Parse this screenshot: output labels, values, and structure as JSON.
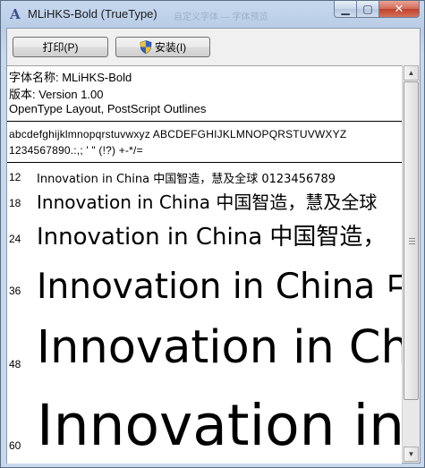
{
  "window": {
    "title": "MLiHKS-Bold (TrueType)",
    "ghost_title": "自定义字体 — 字体预览",
    "minimize_glyph": "▁",
    "maximize_glyph": "▢",
    "close_glyph": "✕"
  },
  "toolbar": {
    "print_label": "打印(P)",
    "install_label": "安装(I)"
  },
  "font_info": {
    "name_line": "字体名称: MLiHKS-Bold",
    "version_line": "版本: Version 1.00",
    "type_line": "OpenType Layout, PostScript Outlines"
  },
  "charset": {
    "line1": "abcdefghijklmnopqrstuvwxyz ABCDEFGHIJKLMNOPQRSTUVWXYZ",
    "line2": "1234567890.:,; ' \" (!?) +-*/="
  },
  "samples": [
    {
      "size": "12",
      "text": "Innovation in China 中国智造，慧及全球 0123456789"
    },
    {
      "size": "18",
      "text": "Innovation in China 中国智造，慧及全球"
    },
    {
      "size": "24",
      "text": "Innovation in China 中国智造，"
    },
    {
      "size": "36",
      "text": "Innovation in China 中"
    },
    {
      "size": "48",
      "text": "Innovation in Ch"
    },
    {
      "size": "60",
      "text": "Innovation in"
    }
  ],
  "scrollbar": {
    "up_glyph": "▲",
    "down_glyph": "▼"
  },
  "colors": {
    "title_bar": "#b9cde6",
    "close_button": "#c0412a",
    "content_bg": "#ffffff",
    "text": "#000000"
  },
  "icons": {
    "app": "font-viewer-icon",
    "install": "uac-shield-icon"
  }
}
